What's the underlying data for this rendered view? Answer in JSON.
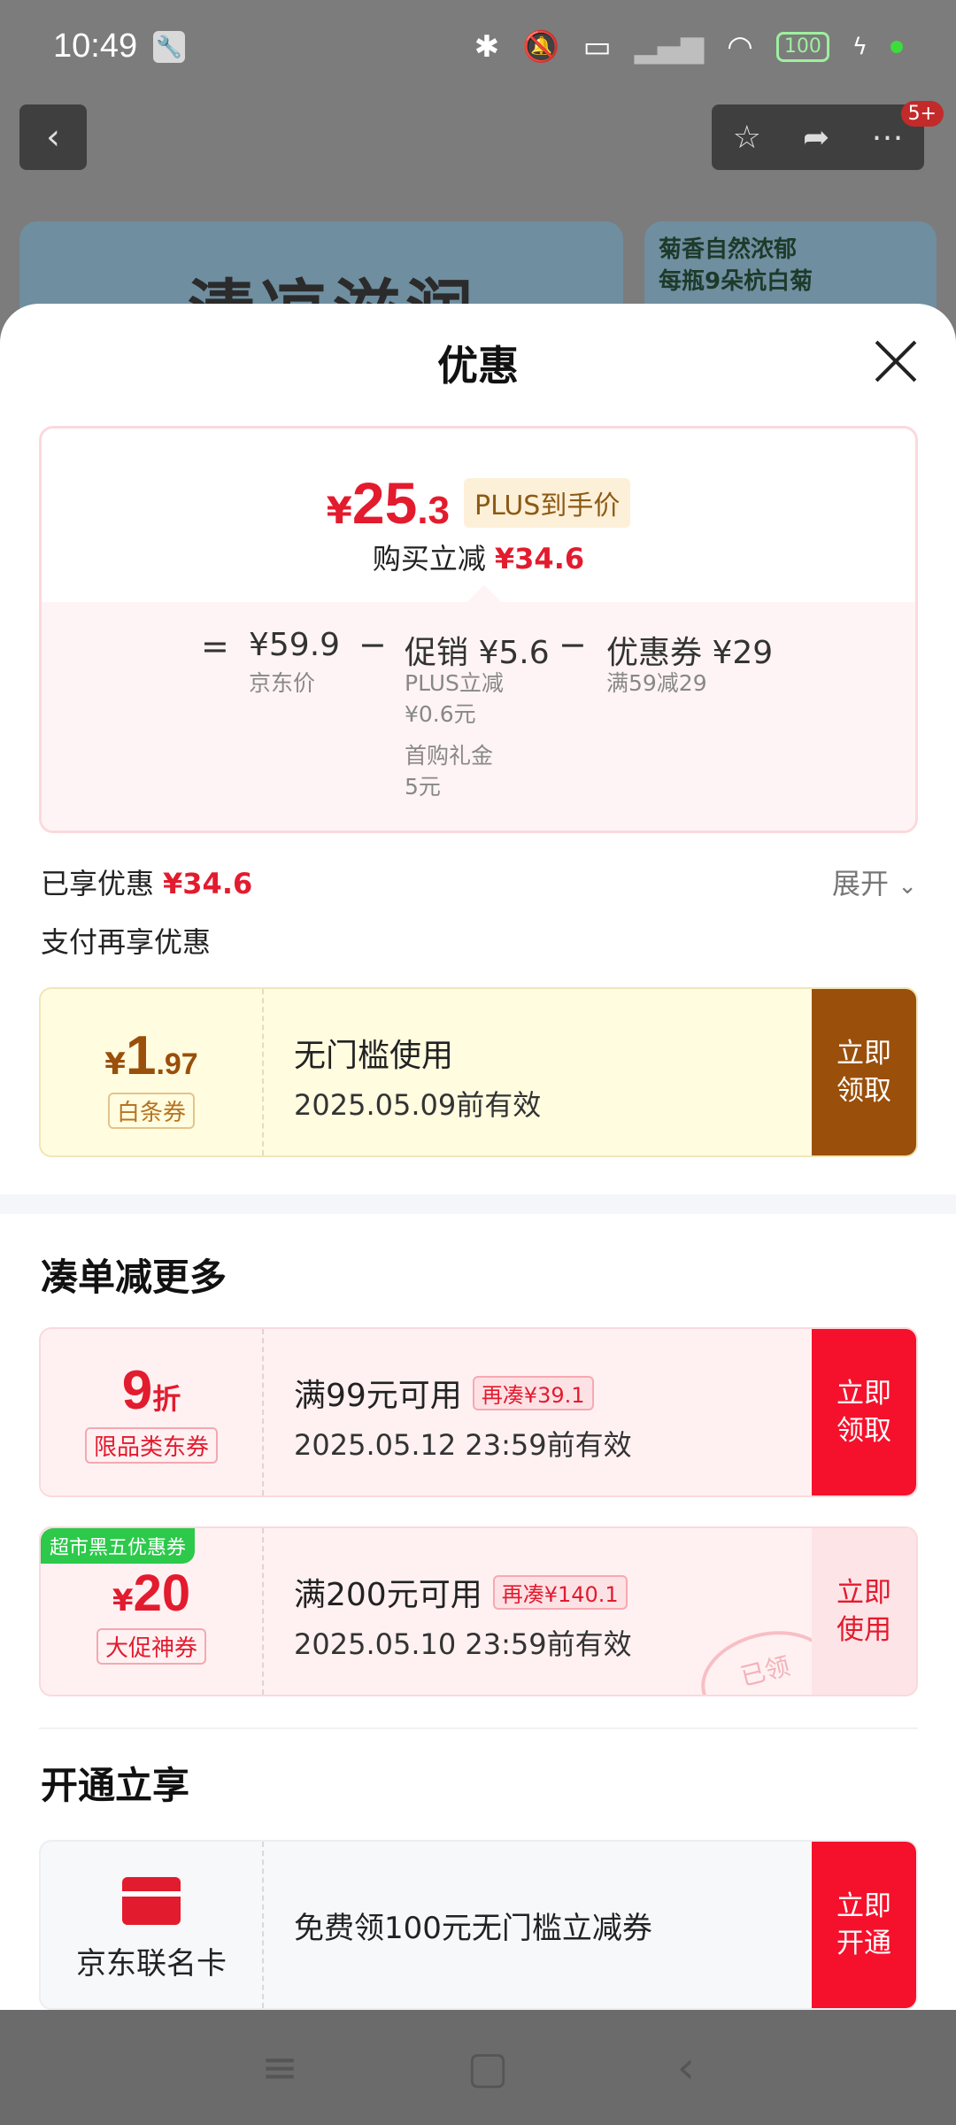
{
  "status_bar": {
    "time": "10:49",
    "battery": "100"
  },
  "background_page": {
    "badge": "5+",
    "banner_left_text": "清凉滋润",
    "banner_right_line1": "菊香自然浓郁",
    "banner_right_line2": "每瓶9朵杭白菊"
  },
  "sheet": {
    "title": "优惠",
    "price_summary": {
      "currency": "¥",
      "price_int": "25",
      "price_dec": ".3",
      "price_tag": "PLUS到手价",
      "reduce_label": "购买立减",
      "reduce_value": "¥34.6",
      "eq": "=",
      "jd_price": "¥59.9",
      "jd_price_label": "京东价",
      "minus1": "−",
      "promo": "促销 ¥5.6",
      "promo_detail1": "PLUS立减",
      "promo_detail2": "¥0.6元",
      "promo_detail3": "首购礼金",
      "promo_detail4": "5元",
      "minus2": "−",
      "coupon": "优惠券 ¥29",
      "coupon_detail": "满59减29"
    },
    "enjoyed_label": "已享优惠",
    "enjoyed_value": "¥34.6",
    "expand_label": "展开",
    "pay_more_label": "支付再享优惠",
    "pay_coupon": {
      "currency": "¥",
      "amount_int": "1",
      "amount_dec": ".97",
      "type": "白条券",
      "title": "无门槛使用",
      "validity": "2025.05.09前有效",
      "button": "立即领取"
    },
    "combine_title": "凑单减更多",
    "combine_coupons": [
      {
        "amount": "9",
        "unit": "折",
        "type": "限品类东券",
        "title": "满99元可用",
        "extra": "再凑¥39.1",
        "validity": "2025.05.12 23:59前有效",
        "button": "立即领取"
      },
      {
        "badge": "超市黑五优惠券",
        "currency": "¥",
        "amount": "20",
        "type": "大促神券",
        "title": "满200元可用",
        "extra": "再凑¥140.1",
        "validity": "2025.05.10 23:59前有效",
        "button": "立即使用",
        "stamp": "已领"
      }
    ],
    "open_title": "开通立享",
    "open_card": {
      "name": "京东联名卡",
      "desc": "免费领100元无门槛立减券",
      "button": "立即开通"
    }
  },
  "colors": {
    "accent_red": "#e31b2e",
    "gold_button": "#9a4f0a"
  }
}
